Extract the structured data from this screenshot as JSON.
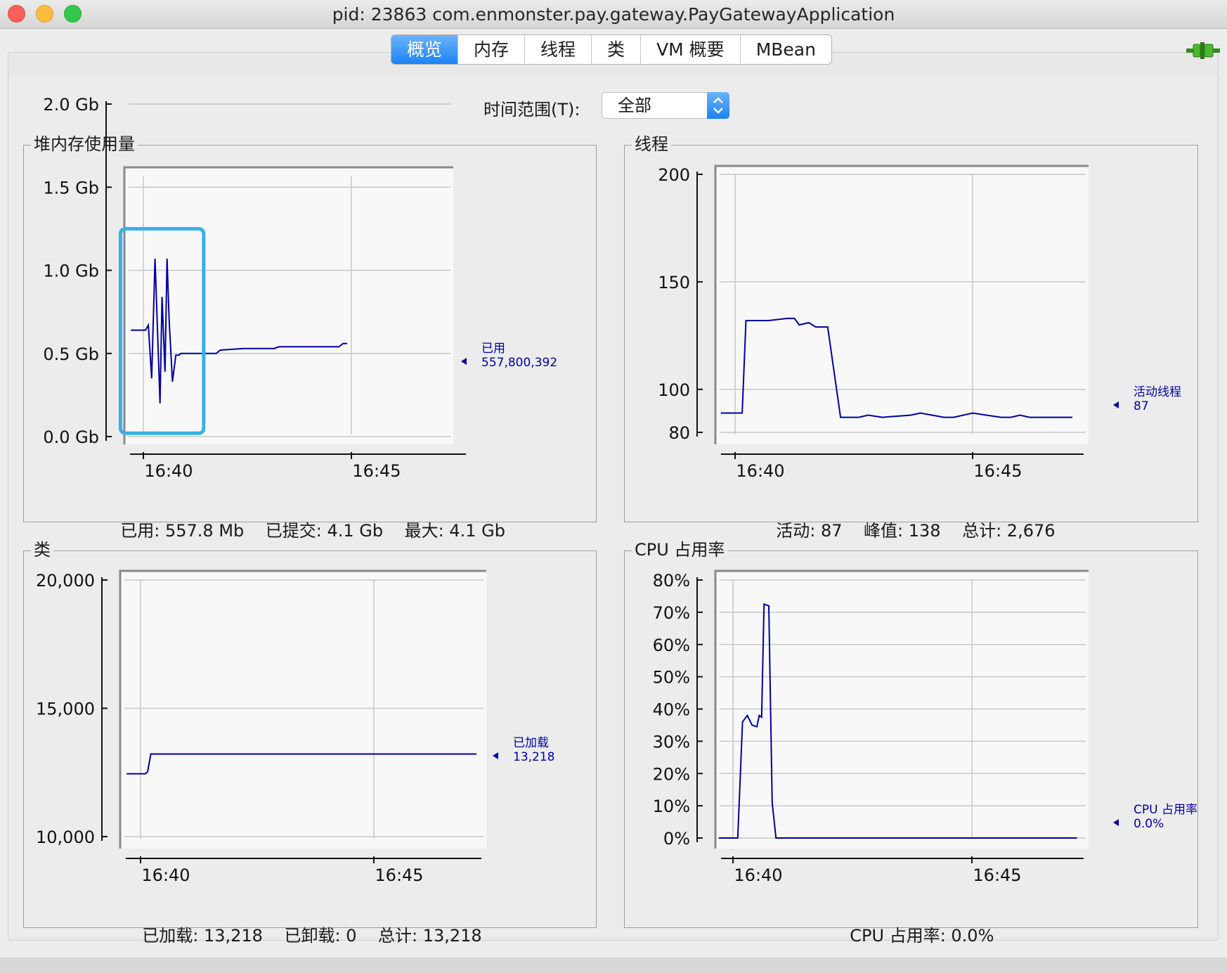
{
  "window": {
    "title": "pid: 23863 com.enmonster.pay.gateway.PayGatewayApplication"
  },
  "tabs": [
    {
      "label": "概览",
      "active": true
    },
    {
      "label": "内存",
      "active": false
    },
    {
      "label": "线程",
      "active": false
    },
    {
      "label": "类",
      "active": false
    },
    {
      "label": "VM 概要",
      "active": false
    },
    {
      "label": "MBean",
      "active": false
    }
  ],
  "time_range": {
    "label": "时间范围(T):",
    "selected": "全部"
  },
  "colors": {
    "line": "#0000a0",
    "accent": "#1c83f6",
    "highlight": "#3daee9"
  },
  "icons": {
    "connection": "connection-plug-icon",
    "select_arrows": "up-down-chevron-icon"
  },
  "panels": {
    "heap": {
      "title": "堆内存使用量",
      "annotation_name": "已用",
      "annotation_value": "557,800,392",
      "summary": {
        "used": "已用: 557.8 Mb",
        "committed": "已提交: 4.1 Gb",
        "max": "最大: 4.1 Gb"
      }
    },
    "threads": {
      "title": "线程",
      "annotation_name": "活动线程",
      "annotation_value": "87",
      "summary": {
        "live": "活动: 87",
        "peak": "峰值: 138",
        "total": "总计: 2,676"
      }
    },
    "classes": {
      "title": "类",
      "annotation_name": "已加载",
      "annotation_value": "13,218",
      "summary": {
        "loaded": "已加载: 13,218",
        "unloaded": "已卸载: 0",
        "total": "总计: 13,218"
      }
    },
    "cpu": {
      "title": "CPU 占用率",
      "annotation_name": "CPU 占用率",
      "annotation_value": "0.0%",
      "summary": {
        "usage": "CPU 占用率: 0.0%"
      }
    }
  },
  "chart_data": [
    {
      "id": "heap",
      "type": "line",
      "title": "堆内存使用量",
      "x_unit": "minutes",
      "x_ticks": [
        {
          "value": 0,
          "label": "16:40"
        },
        {
          "value": 5,
          "label": "16:45"
        }
      ],
      "xlim": [
        -0.3,
        4.9
      ],
      "ylim": [
        0,
        2.0
      ],
      "y_ticks": [
        {
          "value": 0.0,
          "label": "0.0 Gb"
        },
        {
          "value": 0.5,
          "label": "0.5 Gb"
        },
        {
          "value": 1.0,
          "label": "1.0 Gb"
        },
        {
          "value": 1.5,
          "label": "1.5 Gb"
        },
        {
          "value": 2.0,
          "label": "2.0 Gb"
        }
      ],
      "grid": true,
      "highlight_region": {
        "x": [
          -0.55,
          1.45
        ],
        "y": [
          0.02,
          1.25
        ]
      },
      "series": [
        {
          "name": "已用",
          "x": [
            -0.3,
            0.05,
            0.12,
            0.2,
            0.28,
            0.4,
            0.45,
            0.52,
            0.57,
            0.62,
            0.7,
            0.78,
            0.86,
            0.9,
            1.1,
            1.2,
            1.75,
            1.85,
            2.4,
            3.15,
            3.25,
            4.7,
            4.8,
            4.9
          ],
          "y": [
            0.64,
            0.64,
            0.67,
            0.35,
            1.07,
            0.2,
            0.84,
            0.39,
            1.07,
            0.7,
            0.33,
            0.49,
            0.49,
            0.5,
            0.5,
            0.5,
            0.5,
            0.52,
            0.53,
            0.53,
            0.54,
            0.54,
            0.56,
            0.56
          ]
        }
      ]
    },
    {
      "id": "threads",
      "type": "line",
      "title": "线程",
      "x_unit": "minutes",
      "x_ticks": [
        {
          "value": 0,
          "label": "16:40"
        },
        {
          "value": 5,
          "label": "16:45"
        }
      ],
      "xlim": [
        -0.3,
        7.2
      ],
      "ylim": [
        80,
        200
      ],
      "y_ticks": [
        {
          "value": 80,
          "label": "80"
        },
        {
          "value": 100,
          "label": "100"
        },
        {
          "value": 150,
          "label": "150"
        },
        {
          "value": 200,
          "label": "200"
        }
      ],
      "grid": true,
      "series": [
        {
          "name": "活动线程",
          "x": [
            -0.3,
            0.15,
            0.23,
            0.7,
            1.1,
            1.25,
            1.35,
            1.55,
            1.7,
            1.95,
            2.22,
            2.3,
            2.6,
            2.8,
            3.1,
            3.7,
            3.9,
            4.4,
            4.6,
            5.0,
            5.6,
            5.8,
            6.0,
            6.2,
            7.1
          ],
          "y": [
            89,
            89,
            132,
            132,
            133,
            133,
            130,
            131,
            129,
            129,
            87,
            87,
            87,
            88,
            87,
            88,
            89,
            87,
            87,
            89,
            87,
            87,
            88,
            87,
            87
          ]
        }
      ]
    },
    {
      "id": "classes",
      "type": "line",
      "title": "类",
      "x_unit": "minutes",
      "x_ticks": [
        {
          "value": 0,
          "label": "16:40"
        },
        {
          "value": 5,
          "label": "16:45"
        }
      ],
      "xlim": [
        -0.3,
        7.2
      ],
      "ylim": [
        10000,
        20000
      ],
      "y_ticks": [
        {
          "value": 10000,
          "label": "10,000"
        },
        {
          "value": 15000,
          "label": "15,000"
        },
        {
          "value": 20000,
          "label": "20,000"
        }
      ],
      "grid": true,
      "series": [
        {
          "name": "已加载",
          "x": [
            -0.3,
            0.1,
            0.15,
            0.22,
            7.2
          ],
          "y": [
            12450,
            12450,
            12520,
            13218,
            13218
          ]
        }
      ]
    },
    {
      "id": "cpu",
      "type": "line",
      "title": "CPU 占用率",
      "x_unit": "minutes",
      "x_ticks": [
        {
          "value": 0,
          "label": "16:40"
        },
        {
          "value": 5,
          "label": "16:45"
        }
      ],
      "xlim": [
        -0.3,
        7.2
      ],
      "ylim": [
        0,
        80
      ],
      "y_ticks": [
        {
          "value": 0,
          "label": "0%"
        },
        {
          "value": 10,
          "label": "10%"
        },
        {
          "value": 20,
          "label": "20%"
        },
        {
          "value": 30,
          "label": "30%"
        },
        {
          "value": 40,
          "label": "40%"
        },
        {
          "value": 50,
          "label": "50%"
        },
        {
          "value": 60,
          "label": "60%"
        },
        {
          "value": 70,
          "label": "70%"
        },
        {
          "value": 80,
          "label": "80%"
        }
      ],
      "grid": true,
      "series": [
        {
          "name": "CPU 占用率",
          "x": [
            -0.3,
            0.1,
            0.2,
            0.3,
            0.4,
            0.5,
            0.55,
            0.6,
            0.65,
            0.75,
            0.82,
            0.9,
            1.0,
            7.2
          ],
          "y": [
            0,
            0,
            36,
            38,
            35,
            34.5,
            38,
            37.5,
            72.5,
            72,
            11,
            0,
            0,
            0
          ]
        }
      ]
    }
  ]
}
